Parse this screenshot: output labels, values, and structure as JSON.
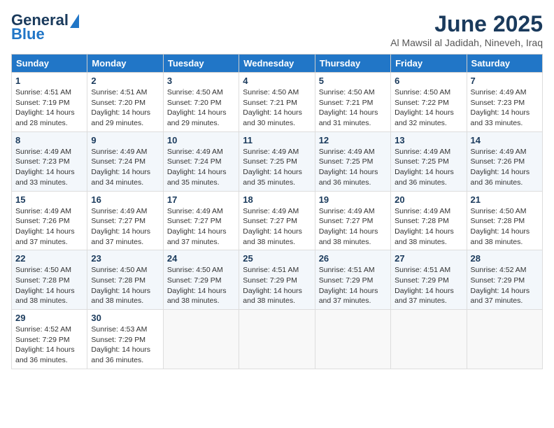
{
  "header": {
    "logo_general": "General",
    "logo_blue": "Blue",
    "title": "June 2025",
    "location": "Al Mawsil al Jadidah, Nineveh, Iraq"
  },
  "columns": [
    "Sunday",
    "Monday",
    "Tuesday",
    "Wednesday",
    "Thursday",
    "Friday",
    "Saturday"
  ],
  "weeks": [
    [
      {
        "day": "1",
        "sunrise": "4:51 AM",
        "sunset": "7:19 PM",
        "daylight": "14 hours and 28 minutes."
      },
      {
        "day": "2",
        "sunrise": "4:51 AM",
        "sunset": "7:20 PM",
        "daylight": "14 hours and 29 minutes."
      },
      {
        "day": "3",
        "sunrise": "4:50 AM",
        "sunset": "7:20 PM",
        "daylight": "14 hours and 29 minutes."
      },
      {
        "day": "4",
        "sunrise": "4:50 AM",
        "sunset": "7:21 PM",
        "daylight": "14 hours and 30 minutes."
      },
      {
        "day": "5",
        "sunrise": "4:50 AM",
        "sunset": "7:21 PM",
        "daylight": "14 hours and 31 minutes."
      },
      {
        "day": "6",
        "sunrise": "4:50 AM",
        "sunset": "7:22 PM",
        "daylight": "14 hours and 32 minutes."
      },
      {
        "day": "7",
        "sunrise": "4:49 AM",
        "sunset": "7:23 PM",
        "daylight": "14 hours and 33 minutes."
      }
    ],
    [
      {
        "day": "8",
        "sunrise": "4:49 AM",
        "sunset": "7:23 PM",
        "daylight": "14 hours and 33 minutes."
      },
      {
        "day": "9",
        "sunrise": "4:49 AM",
        "sunset": "7:24 PM",
        "daylight": "14 hours and 34 minutes."
      },
      {
        "day": "10",
        "sunrise": "4:49 AM",
        "sunset": "7:24 PM",
        "daylight": "14 hours and 35 minutes."
      },
      {
        "day": "11",
        "sunrise": "4:49 AM",
        "sunset": "7:25 PM",
        "daylight": "14 hours and 35 minutes."
      },
      {
        "day": "12",
        "sunrise": "4:49 AM",
        "sunset": "7:25 PM",
        "daylight": "14 hours and 36 minutes."
      },
      {
        "day": "13",
        "sunrise": "4:49 AM",
        "sunset": "7:25 PM",
        "daylight": "14 hours and 36 minutes."
      },
      {
        "day": "14",
        "sunrise": "4:49 AM",
        "sunset": "7:26 PM",
        "daylight": "14 hours and 36 minutes."
      }
    ],
    [
      {
        "day": "15",
        "sunrise": "4:49 AM",
        "sunset": "7:26 PM",
        "daylight": "14 hours and 37 minutes."
      },
      {
        "day": "16",
        "sunrise": "4:49 AM",
        "sunset": "7:27 PM",
        "daylight": "14 hours and 37 minutes."
      },
      {
        "day": "17",
        "sunrise": "4:49 AM",
        "sunset": "7:27 PM",
        "daylight": "14 hours and 37 minutes."
      },
      {
        "day": "18",
        "sunrise": "4:49 AM",
        "sunset": "7:27 PM",
        "daylight": "14 hours and 38 minutes."
      },
      {
        "day": "19",
        "sunrise": "4:49 AM",
        "sunset": "7:27 PM",
        "daylight": "14 hours and 38 minutes."
      },
      {
        "day": "20",
        "sunrise": "4:49 AM",
        "sunset": "7:28 PM",
        "daylight": "14 hours and 38 minutes."
      },
      {
        "day": "21",
        "sunrise": "4:50 AM",
        "sunset": "7:28 PM",
        "daylight": "14 hours and 38 minutes."
      }
    ],
    [
      {
        "day": "22",
        "sunrise": "4:50 AM",
        "sunset": "7:28 PM",
        "daylight": "14 hours and 38 minutes."
      },
      {
        "day": "23",
        "sunrise": "4:50 AM",
        "sunset": "7:28 PM",
        "daylight": "14 hours and 38 minutes."
      },
      {
        "day": "24",
        "sunrise": "4:50 AM",
        "sunset": "7:29 PM",
        "daylight": "14 hours and 38 minutes."
      },
      {
        "day": "25",
        "sunrise": "4:51 AM",
        "sunset": "7:29 PM",
        "daylight": "14 hours and 38 minutes."
      },
      {
        "day": "26",
        "sunrise": "4:51 AM",
        "sunset": "7:29 PM",
        "daylight": "14 hours and 37 minutes."
      },
      {
        "day": "27",
        "sunrise": "4:51 AM",
        "sunset": "7:29 PM",
        "daylight": "14 hours and 37 minutes."
      },
      {
        "day": "28",
        "sunrise": "4:52 AM",
        "sunset": "7:29 PM",
        "daylight": "14 hours and 37 minutes."
      }
    ],
    [
      {
        "day": "29",
        "sunrise": "4:52 AM",
        "sunset": "7:29 PM",
        "daylight": "14 hours and 36 minutes."
      },
      {
        "day": "30",
        "sunrise": "4:53 AM",
        "sunset": "7:29 PM",
        "daylight": "14 hours and 36 minutes."
      },
      null,
      null,
      null,
      null,
      null
    ]
  ]
}
